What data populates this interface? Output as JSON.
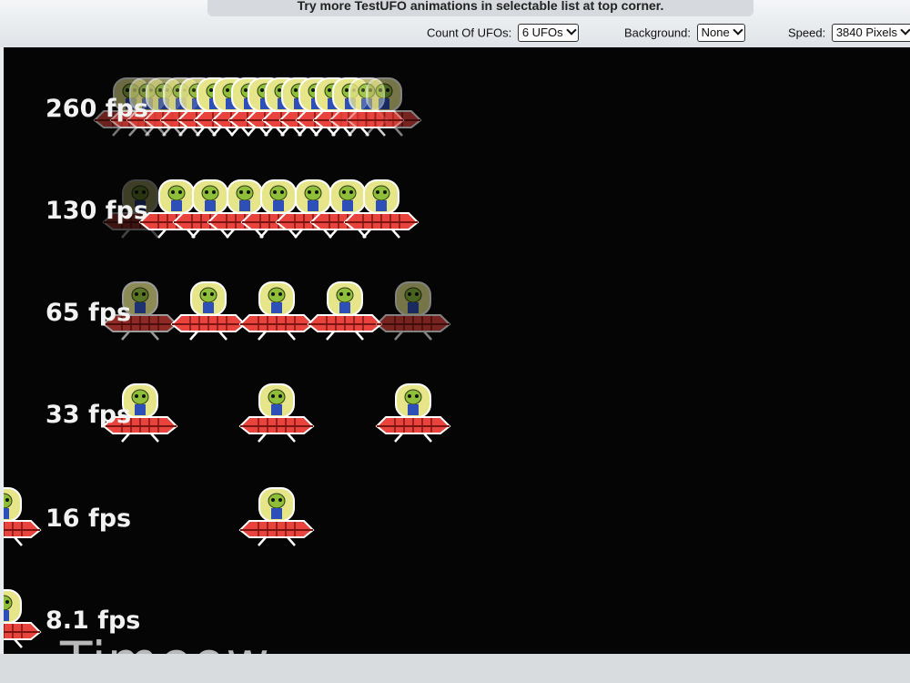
{
  "header": {
    "notice": "Try more TestUFO animations in selectable list at top corner."
  },
  "controls": {
    "count_label": "Count Of UFOs:",
    "count_value": "6 UFOs",
    "background_label": "Background:",
    "background_value": "None",
    "speed_label": "Speed:",
    "speed_value": "3840 Pixels"
  },
  "rows": [
    {
      "label": "260 fps",
      "ufo_positions": [
        140,
        158,
        176,
        195,
        213,
        232,
        250,
        270,
        288,
        307,
        325,
        344,
        362,
        381,
        399,
        418
      ],
      "ghost_alphas": [
        0.45,
        0.55,
        0.65,
        0.75,
        0.85,
        1,
        1,
        1,
        1,
        1,
        1,
        1,
        1,
        1,
        0.8,
        0.5
      ]
    },
    {
      "label": "130 fps",
      "ufo_positions": [
        150,
        190,
        227,
        265,
        302,
        340,
        378,
        415
      ],
      "ghost_alphas": [
        0.25,
        1,
        1,
        1,
        1,
        1,
        1,
        1
      ]
    },
    {
      "label": "65 fps",
      "ufo_positions": [
        150,
        225,
        300,
        375,
        450
      ],
      "ghost_alphas": [
        0.6,
        1,
        1,
        1,
        0.5
      ]
    },
    {
      "label": "33 fps",
      "ufo_positions": [
        150,
        300,
        450
      ],
      "ghost_alphas": [
        1,
        1,
        1
      ]
    },
    {
      "label": "16 fps",
      "ufo_positions": [
        0,
        300
      ],
      "ghost_alphas": [
        1,
        1
      ]
    },
    {
      "label": "8.1 fps",
      "ufo_positions": [
        0
      ],
      "ghost_alphas": [
        1
      ]
    }
  ],
  "watermark": "Timeow",
  "colors": {
    "stage_bg": "#050505",
    "saucer_red": "#e8433c",
    "alien_green": "#8fbf3a",
    "dome_yellow": "#e7e58a"
  },
  "icons": [
    "ufo-icon",
    "chevron-down-icon"
  ]
}
